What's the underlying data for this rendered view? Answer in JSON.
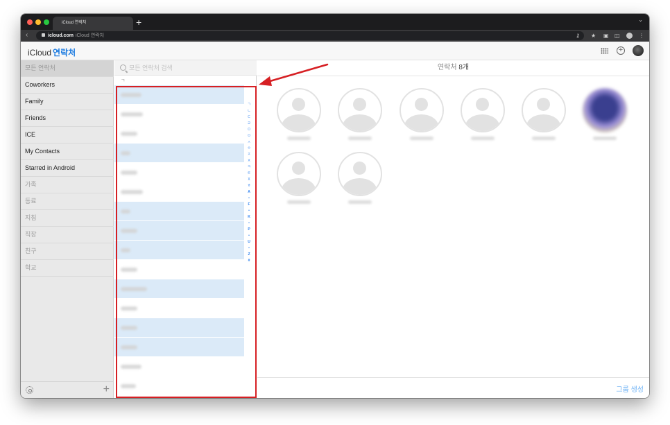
{
  "browser": {
    "tab_title": "iCloud 연락처",
    "new_tab": "+",
    "tab_menu": "⌄",
    "back": "‹",
    "url_domain": "icloud.com",
    "url_page_title": "iCloud 연락처"
  },
  "app": {
    "brand": "iCloud",
    "app_name": "연락처"
  },
  "sidebar": {
    "items": [
      {
        "label": "모든 연락처"
      },
      {
        "label": "Coworkers"
      },
      {
        "label": "Family"
      },
      {
        "label": "Friends"
      },
      {
        "label": "ICE"
      },
      {
        "label": "My Contacts"
      },
      {
        "label": "Starred in Android"
      },
      {
        "label": "가족"
      },
      {
        "label": "동료"
      },
      {
        "label": "지침"
      },
      {
        "label": "직장"
      },
      {
        "label": "친구"
      },
      {
        "label": "학교"
      }
    ],
    "add_label": "+"
  },
  "list": {
    "search_placeholder": "모든 연락처 검색",
    "section_header": "ㄱ",
    "index": [
      "ㄱ",
      "ㄴ",
      "ㄷ",
      "ㄹ",
      "ㅁ",
      "ㅂ",
      "ㅅ",
      "ㅇ",
      "ㅈ",
      "ㅊ",
      "ㅋ",
      "ㅌ",
      "ㅍ",
      "ㅎ",
      "A",
      "•",
      "F",
      "•",
      "K",
      "•",
      "P",
      "•",
      "U",
      "•",
      "Z",
      "#"
    ]
  },
  "main": {
    "header_prefix": "연락처 ",
    "header_count": "8개",
    "new_group": "그룹 생성"
  },
  "colors": {
    "accent": "#1a7ae0",
    "highlight_row": "#dbeaf8",
    "annotation": "#d61f23"
  }
}
